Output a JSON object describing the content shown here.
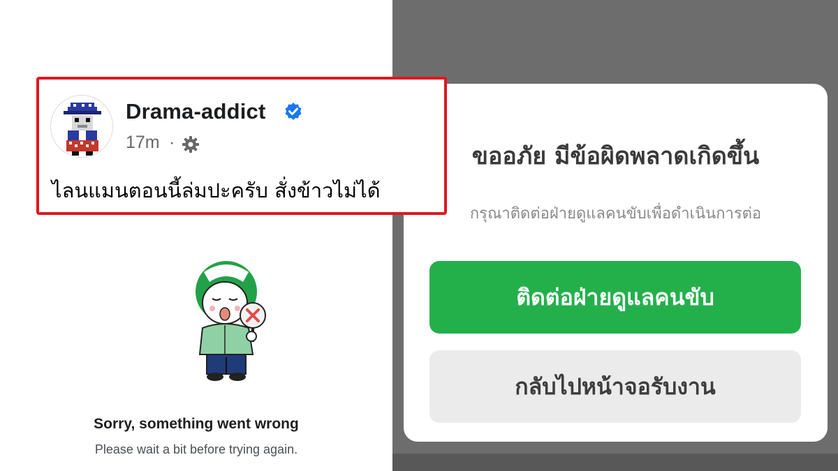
{
  "facebook_post": {
    "author": "Drama-addict",
    "time": "17m",
    "separator": "·",
    "text": "ไลนแมนตอนนี้ล่มปะครับ สั่งข้าวไม่ได้",
    "icons": [
      "avatar",
      "verified-badge-icon",
      "audience-gear-icon"
    ]
  },
  "left_error": {
    "title": "Sorry, something went wrong",
    "subtitle": "Please wait a bit before trying again.",
    "illustration": "lineman-mascot-error"
  },
  "dialog": {
    "title": "ขออภัย มีข้อผิดพลาดเกิดขึ้น",
    "message": "กรุณาติดต่อฝ่ายดูแลคนขับเพื่อดำเนินการต่อ",
    "primary_button": "ติดต่อฝ่ายดูแลคนขับ",
    "secondary_button": "กลับไปหน้าจอรับงาน"
  },
  "colors": {
    "highlight_border": "#e0161d",
    "primary_green": "#23b04b",
    "secondary_gray": "#ebebeb",
    "overlay_gray": "#6d6d6d",
    "facebook_blue": "#1877f2"
  }
}
